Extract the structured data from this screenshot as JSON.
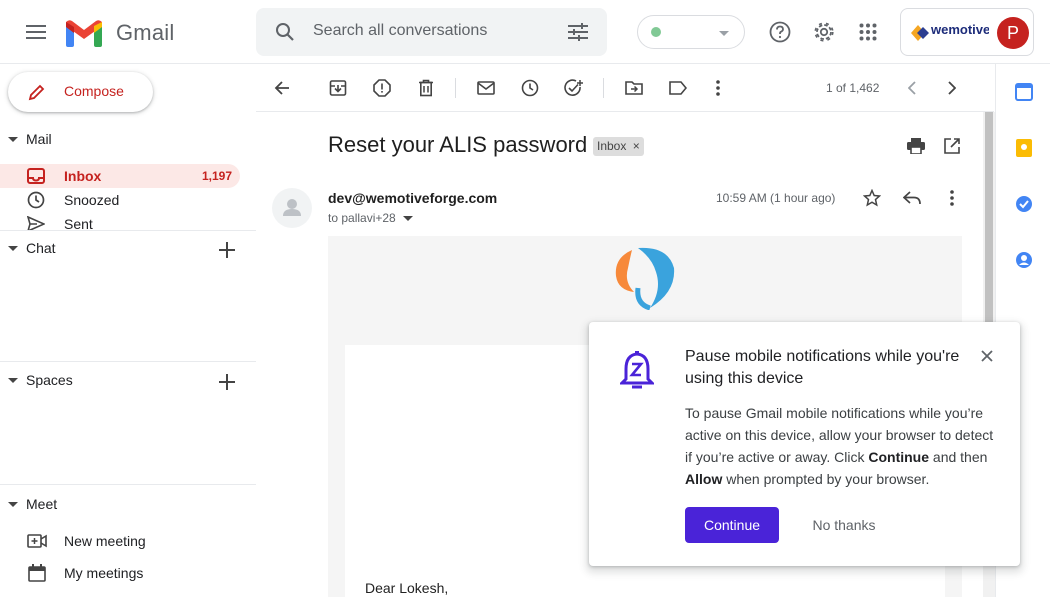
{
  "header": {
    "app_name": "Gmail",
    "search_placeholder": "Search all conversations",
    "brand_text": "wemotive",
    "avatar_letter": "P"
  },
  "sidebar": {
    "compose_label": "Compose",
    "mail_heading": "Mail",
    "items": [
      {
        "label": "Inbox",
        "count": "1,197"
      },
      {
        "label": "Snoozed"
      },
      {
        "label": "Sent"
      }
    ],
    "chat_heading": "Chat",
    "spaces_heading": "Spaces",
    "meet_heading": "Meet",
    "meet_items": [
      {
        "label": "New meeting"
      },
      {
        "label": "My meetings"
      }
    ]
  },
  "toolbar": {
    "page_count": "1 of 1,462"
  },
  "email": {
    "subject": "Reset your ALIS password",
    "label_chip": "Inbox",
    "sender": "dev@wemotiveforge.com",
    "recipient": "to pallavi+28",
    "time": "10:59 AM (1 hour ago)",
    "greeting": "Dear Lokesh,"
  },
  "popup": {
    "title": "Pause mobile notifications while you're using this device",
    "body_part1": "To pause Gmail mobile notifications while you’re active on this device, allow your browser to detect if you’re active or away. Click ",
    "body_bold1": "Continue",
    "body_part2": " and then ",
    "body_bold2": "Allow",
    "body_part3": " when prompted by your browser.",
    "continue_label": "Continue",
    "no_thanks_label": "No thanks"
  },
  "colors": {
    "accent": "#c5221f",
    "popup_button": "#4a23d8",
    "status_dot": "#81c995"
  }
}
